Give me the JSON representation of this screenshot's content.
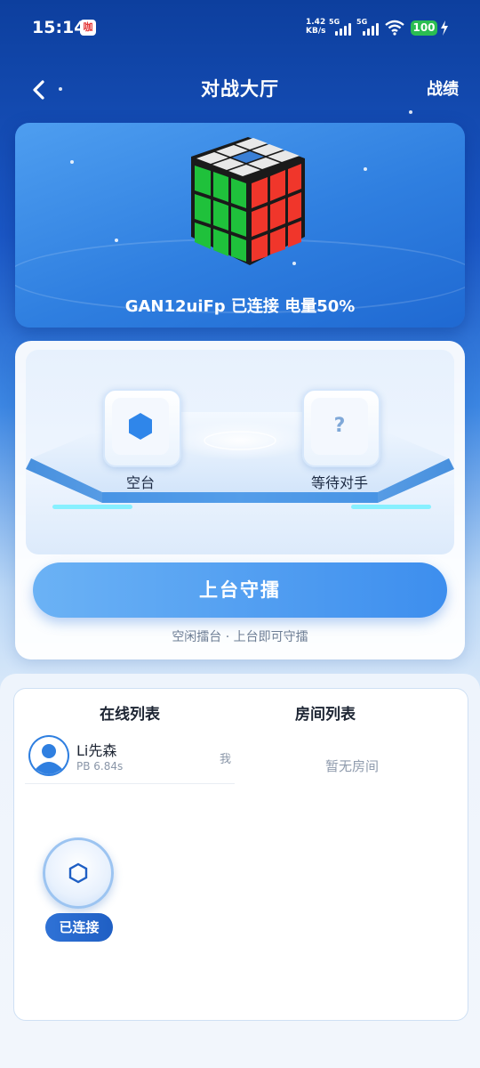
{
  "status_bar": {
    "time": "15:14",
    "app_badge": "咖",
    "net_speed_value": "1.42",
    "net_speed_unit": "KB/s",
    "sim1_label": "5G",
    "sim2_label": "5G",
    "battery": "100"
  },
  "header": {
    "title": "对战大厅",
    "right_action": "战绩"
  },
  "device": {
    "status_text": "GAN12uiFp 已连接 电量50%"
  },
  "arena": {
    "left_seat_label": "空台",
    "right_seat_label": "等待对手",
    "right_seat_symbol": "?",
    "button_label": "上台守擂",
    "hint": "空闲擂台 · 上台即可守擂"
  },
  "lists": {
    "online_tab": "在线列表",
    "rooms_tab": "房间列表",
    "users": [
      {
        "name": "Li先森",
        "pb": "PB 6.84s",
        "tag": "我"
      }
    ],
    "rooms_empty": "暂无房间"
  },
  "floating": {
    "badge": "已连接"
  },
  "colors": {
    "primary_blue": "#2f7fe0",
    "battery_green": "#2bbd52"
  }
}
